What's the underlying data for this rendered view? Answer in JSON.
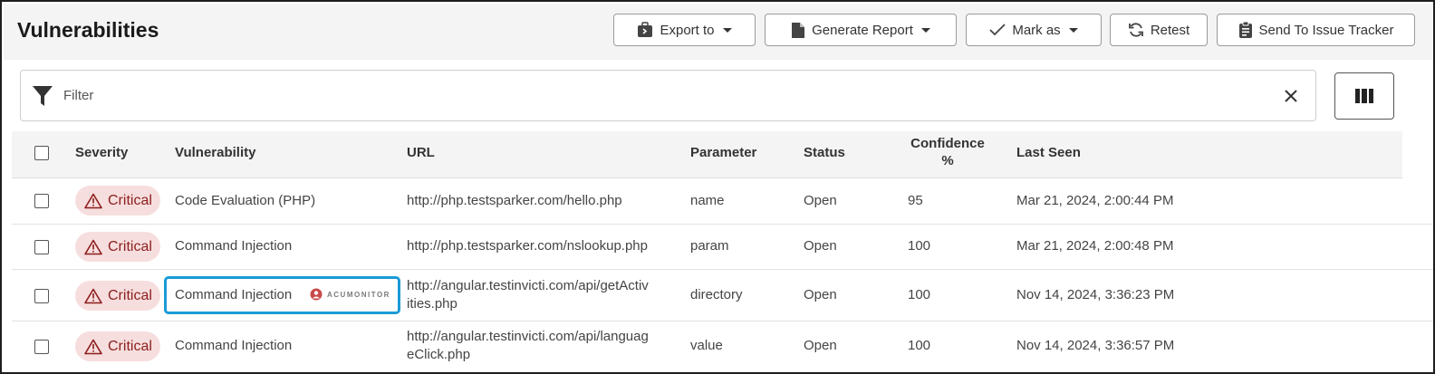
{
  "header": {
    "title": "Vulnerabilities",
    "buttons": {
      "export": "Export to",
      "generate": "Generate Report",
      "mark": "Mark as",
      "retest": "Retest",
      "send": "Send To Issue Tracker"
    }
  },
  "filter": {
    "placeholder": "Filter"
  },
  "table": {
    "columns": {
      "severity": "Severity",
      "vulnerability": "Vulnerability",
      "url": "URL",
      "parameter": "Parameter",
      "status": "Status",
      "confidence_line1": "Confidence",
      "confidence_line2": "%",
      "last_seen": "Last Seen"
    },
    "rows": [
      {
        "severity": "Critical",
        "vulnerability": "Code Evaluation (PHP)",
        "url_line1": "http://php.testsparker.com/hello.php",
        "url_line2": "",
        "parameter": "name",
        "status": "Open",
        "confidence": "95",
        "last_seen": "Mar 21, 2024, 2:00:44 PM"
      },
      {
        "severity": "Critical",
        "vulnerability": "Command Injection",
        "url_line1": "http://php.testsparker.com/nslookup.php",
        "url_line2": "",
        "parameter": "param",
        "status": "Open",
        "confidence": "100",
        "last_seen": "Mar 21, 2024, 2:00:48 PM"
      },
      {
        "severity": "Critical",
        "vulnerability": "Command Injection",
        "badge_logo": "ACUMONITOR",
        "url_line1": "http://angular.testinvicti.com/api/getActiv",
        "url_line2": "ities.php",
        "parameter": "directory",
        "status": "Open",
        "confidence": "100",
        "last_seen": "Nov 14, 2024, 3:36:23 PM"
      },
      {
        "severity": "Critical",
        "vulnerability": "Command Injection",
        "url_line1": "http://angular.testinvicti.com/api/languag",
        "url_line2": "eClick.php",
        "parameter": "value",
        "status": "Open",
        "confidence": "100",
        "last_seen": "Nov 14, 2024, 3:36:57 PM"
      }
    ]
  },
  "colors": {
    "critical_text": "#8c1d1d",
    "critical_bg": "#f7dede",
    "highlight_border": "#1a9ad6",
    "header_bg": "#f4f4f4"
  },
  "icons": {
    "export": "export-briefcase-icon",
    "generate": "document-icon",
    "mark": "checkmark-icon",
    "retest": "refresh-icon",
    "send": "clipboard-icon",
    "filter": "funnel-icon",
    "clear": "close-icon",
    "columns": "columns-icon",
    "severity": "warning-triangle-icon"
  }
}
